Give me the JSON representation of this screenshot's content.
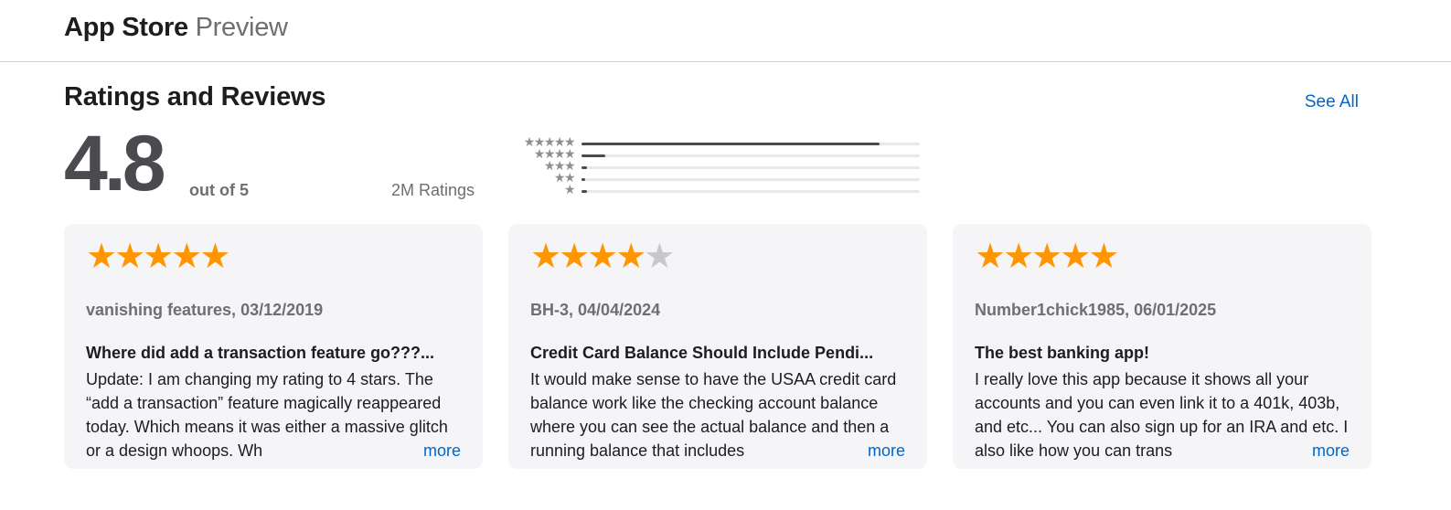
{
  "header": {
    "brand_primary": "App Store",
    "brand_secondary": "Preview"
  },
  "section": {
    "title": "Ratings and Reviews",
    "see_all": "See All"
  },
  "summary": {
    "score": "4.8",
    "out_of": "out of 5",
    "count": "2M Ratings",
    "histogram": [
      {
        "stars": 5,
        "fraction": 0.88
      },
      {
        "stars": 4,
        "fraction": 0.07
      },
      {
        "stars": 3,
        "fraction": 0.015
      },
      {
        "stars": 2,
        "fraction": 0.01
      },
      {
        "stars": 1,
        "fraction": 0.015
      }
    ]
  },
  "icons": {
    "star": "★"
  },
  "colors": {
    "star_on": "#ff9500",
    "star_off": "#c7c7cc",
    "link": "#0066cc",
    "bar": "#4a4a4f"
  },
  "reviews": [
    {
      "rating": 5,
      "author": "vanishing features",
      "date": "03/12/2019",
      "title": "Where did add a transaction feature go???...",
      "body": "Update: I am changing my rating to 4 stars. The “add a transaction” feature magically reappeared today. Which means it was either a massive glitch or a design whoops. Wh",
      "more": "more"
    },
    {
      "rating": 4,
      "author": "BH-3",
      "date": "04/04/2024",
      "title": "Credit Card Balance Should Include Pendi...",
      "body": "It would make sense to have the USAA credit card balance work like the checking account balance where you can see the actual balance and then a running balance that includes",
      "more": "more"
    },
    {
      "rating": 5,
      "author": "Number1chick1985",
      "date": "06/01/2025",
      "title": "The best banking app!",
      "body": "I really love this app because it shows all your accounts and you can even link it to a 401k, 403b, and etc... You can also sign up for an IRA and etc. I also like how you can trans",
      "more": "more"
    }
  ]
}
